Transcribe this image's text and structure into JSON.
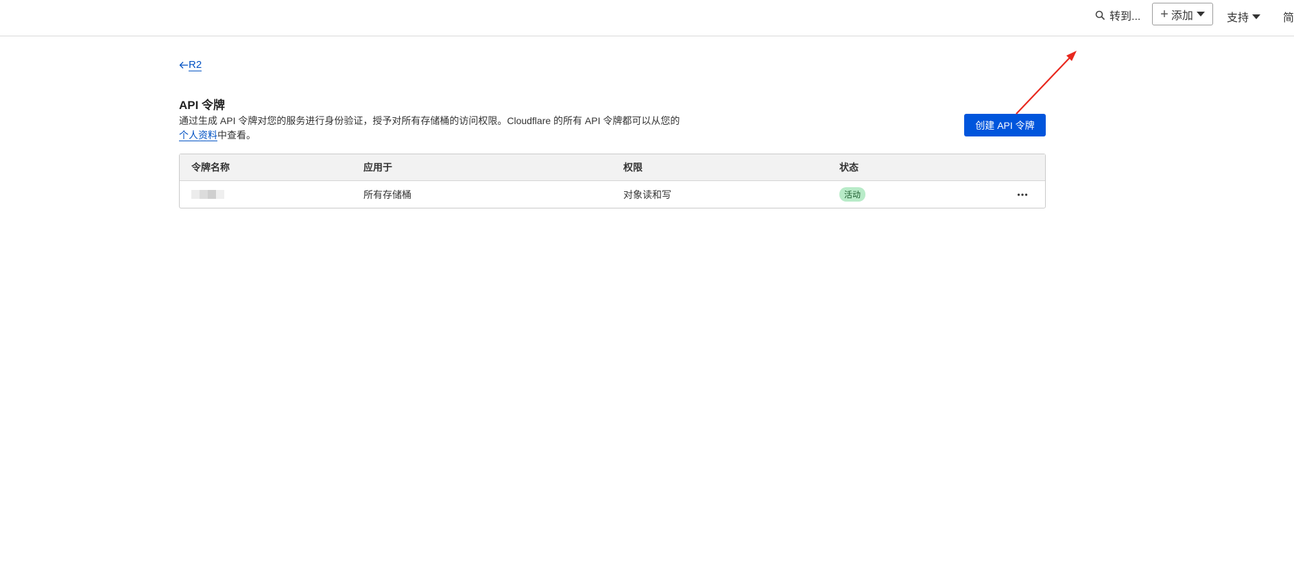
{
  "topbar": {
    "search_label": "转到...",
    "add_label": "添加",
    "support_label": "支持",
    "language_label": "简"
  },
  "breadcrumb": {
    "back_label": "R2"
  },
  "page": {
    "title": "API 令牌",
    "description_part1": "通过生成 API 令牌对您的服务进行身份验证，授予对所有存储桶的访问权限。Cloudflare 的所有 API 令牌都可以从您的",
    "profile_link": "个人资料",
    "description_part2": "中查看。",
    "create_button": "创建 API 令牌"
  },
  "table": {
    "columns": [
      "令牌名称",
      "应用于",
      "权限",
      "状态"
    ],
    "rows": [
      {
        "name": "",
        "applies_to": "所有存储桶",
        "permission": "对象读和写",
        "status": "活动"
      }
    ]
  },
  "colors": {
    "primary_button": "#0055dc",
    "link": "#0051c3",
    "status_active_bg": "#b8ebc8",
    "annotation_arrow": "#e8281e"
  }
}
